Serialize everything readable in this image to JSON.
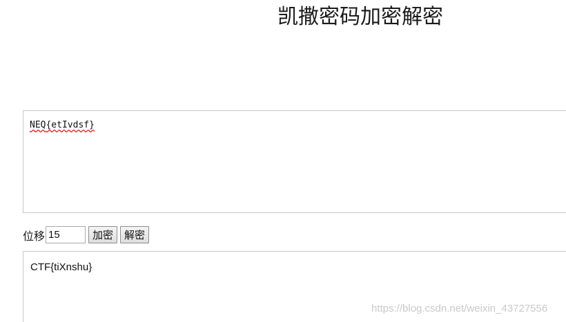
{
  "page": {
    "title": "凯撒密码加密解密"
  },
  "input": {
    "value_prefix": "NEQ",
    "value_rest": "{etIvdsf}"
  },
  "controls": {
    "shift_label": "位移",
    "shift_value": "15",
    "encrypt_label": "加密",
    "decrypt_label": "解密"
  },
  "output": {
    "value": "CTF{tiXnshu}"
  },
  "watermark": {
    "text": "https://blog.csdn.net/weixin_43727556"
  }
}
